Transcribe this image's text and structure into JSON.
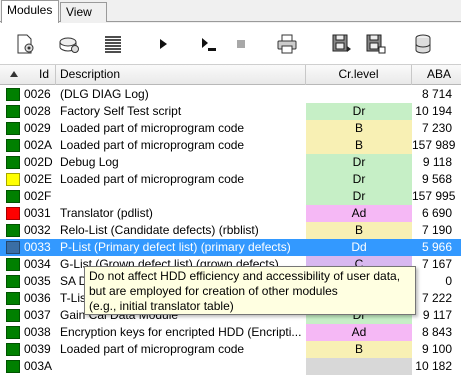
{
  "tabs": [
    {
      "label": "Modules",
      "active": true
    },
    {
      "label": "View",
      "active": false
    }
  ],
  "toolbar": {
    "buttons": [
      {
        "name": "load-module-button",
        "icon": "gear-page-icon"
      },
      {
        "name": "save-module-button",
        "icon": "disk-gear-icon"
      },
      {
        "name": "list-view-button",
        "icon": "list-icon"
      },
      {
        "name": "run-button",
        "icon": "play-icon"
      },
      {
        "name": "run-step-button",
        "icon": "step-icon"
      },
      {
        "name": "stop-button",
        "icon": "stop-icon"
      },
      {
        "name": "print-button",
        "icon": "printer-icon"
      },
      {
        "name": "read-disk-button",
        "icon": "floppy-read-icon"
      },
      {
        "name": "write-disk-button",
        "icon": "floppy-write-icon"
      },
      {
        "name": "database-button",
        "icon": "database-icon"
      }
    ]
  },
  "table": {
    "headers": {
      "id": "Id",
      "description": "Description",
      "cr_level": "Cr.level",
      "aba": "ABA"
    },
    "rows": [
      {
        "id": "0026",
        "desc": " (DLG DIAG Log)",
        "cr": "",
        "aba": "8 714",
        "status": "#008000",
        "crColor": ""
      },
      {
        "id": "0028",
        "desc": "Factory Self Test script",
        "cr": "Dr",
        "aba": "10 194",
        "status": "#008000",
        "crColor": "#c6efc6"
      },
      {
        "id": "0029",
        "desc": "Loaded part of microprogram code",
        "cr": "B",
        "aba": "7 230",
        "status": "#008000",
        "crColor": "#f8f0b4"
      },
      {
        "id": "002A",
        "desc": "Loaded part of microprogram code",
        "cr": "B",
        "aba": "157 989",
        "status": "#008000",
        "crColor": "#f8f0b4"
      },
      {
        "id": "002D",
        "desc": "Debug Log",
        "cr": "Dr",
        "aba": "9 118",
        "status": "#008000",
        "crColor": "#c6efc6"
      },
      {
        "id": "002E",
        "desc": "Loaded part of microprogram code",
        "cr": "Dr",
        "aba": "9 568",
        "status": "#ffff00",
        "crColor": "#c6efc6"
      },
      {
        "id": "002F",
        "desc": "",
        "cr": "Dr",
        "aba": "157 995",
        "status": "#008000",
        "crColor": "#c6efc6"
      },
      {
        "id": "0031",
        "desc": "Translator (pdlist)",
        "cr": "Ad",
        "aba": "6 690",
        "status": "#ff0000",
        "crColor": "#f5b8f5"
      },
      {
        "id": "0032",
        "desc": "Relo-List (Candidate defects) (rbblist)",
        "cr": "B",
        "aba": "7 190",
        "status": "#008000",
        "crColor": "#f8f0b4"
      },
      {
        "id": "0033",
        "desc": "P-List (Primary defect list) (primary defects)",
        "cr": "Dd",
        "aba": "5 966",
        "status": "#3a6ea5",
        "crColor": "",
        "selected": true
      },
      {
        "id": "0034",
        "desc": "G-List (Grown defect list) (grown defects)",
        "cr": "C",
        "aba": "7 167",
        "status": "#008000",
        "crColor": "#d8b8f0"
      },
      {
        "id": "0035",
        "desc": "SA Dump",
        "cr": "",
        "aba": "0",
        "status": "#008000",
        "crColor": ""
      },
      {
        "id": "0036",
        "desc": "T-List",
        "cr": "",
        "aba": "7 222",
        "status": "#008000",
        "crColor": ""
      },
      {
        "id": "0037",
        "desc": "Gain Cal Data Module",
        "cr": "Dr",
        "aba": "9 117",
        "status": "#008000",
        "crColor": "#c6efc6"
      },
      {
        "id": "0038",
        "desc": "Encryption keys for encripted HDD (Encripti...",
        "cr": "Ad",
        "aba": "8 843",
        "status": "#008000",
        "crColor": "#f5b8f5"
      },
      {
        "id": "0039",
        "desc": "Loaded part of microprogram code",
        "cr": "B",
        "aba": "9 100",
        "status": "#008000",
        "crColor": "#f8f0b4"
      },
      {
        "id": "003A",
        "desc": "",
        "cr": "",
        "aba": "10 182",
        "status": "#008000",
        "crColor": "#d8d8d8"
      }
    ]
  },
  "tooltip": {
    "lines": [
      "Do not affect HDD efficiency and accessibility of user data,",
      "but are employed for creation of other modules",
      "(e.g., initial translator table)"
    ]
  }
}
